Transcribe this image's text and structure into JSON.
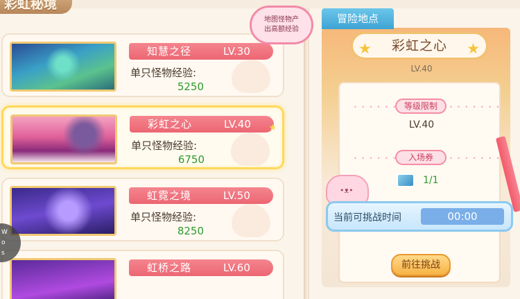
{
  "screen_title": "彩虹秘境",
  "badge": {
    "line1": "地图怪物产",
    "line2": "出高额经验"
  },
  "maps": [
    {
      "name": "知慧之径",
      "level": "LV.30",
      "exp_label": "单只怪物经验:",
      "exp_value": "5250",
      "selected": false
    },
    {
      "name": "彩虹之心",
      "level": "LV.40",
      "exp_label": "单只怪物经验:",
      "exp_value": "6750",
      "selected": true
    },
    {
      "name": "虹霓之境",
      "level": "LV.50",
      "exp_label": "单只怪物经验:",
      "exp_value": "8250",
      "selected": false
    },
    {
      "name": "虹桥之路",
      "level": "LV.60",
      "exp_label": "",
      "exp_value": "",
      "selected": false
    }
  ],
  "detail": {
    "tab_label": "冒险地点",
    "title": "彩虹之心",
    "level": "LV.40",
    "level_req_tag": "等级限制",
    "level_req_value": "LV.40",
    "ticket_tag": "入场券",
    "ticket_count": "1/1",
    "timer_label": "当前可挑战时间",
    "timer_value": "00:00",
    "go_button": "前往挑战"
  },
  "side_float": {
    "line1": "W",
    "line2": "o",
    "line3": "s"
  },
  "icons": {
    "star": "star-icon",
    "ticket": "ticket-icon",
    "mascot": "cat-mascot-icon"
  },
  "colors": {
    "name_bar": "#ec6673",
    "exp_value": "#2d9a2d",
    "timer_fill": "#7aaee8",
    "tab": "#3ea4d4",
    "selected_border": "#ffd85c"
  }
}
